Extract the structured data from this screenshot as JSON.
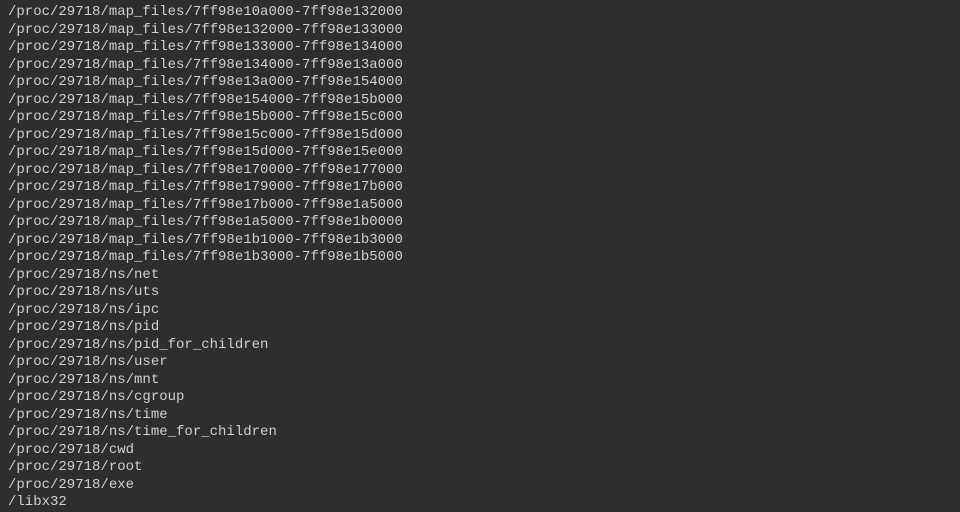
{
  "terminal": {
    "lines": [
      "/proc/29718/map_files/7ff98e10a000-7ff98e132000",
      "/proc/29718/map_files/7ff98e132000-7ff98e133000",
      "/proc/29718/map_files/7ff98e133000-7ff98e134000",
      "/proc/29718/map_files/7ff98e134000-7ff98e13a000",
      "/proc/29718/map_files/7ff98e13a000-7ff98e154000",
      "/proc/29718/map_files/7ff98e154000-7ff98e15b000",
      "/proc/29718/map_files/7ff98e15b000-7ff98e15c000",
      "/proc/29718/map_files/7ff98e15c000-7ff98e15d000",
      "/proc/29718/map_files/7ff98e15d000-7ff98e15e000",
      "/proc/29718/map_files/7ff98e170000-7ff98e177000",
      "/proc/29718/map_files/7ff98e179000-7ff98e17b000",
      "/proc/29718/map_files/7ff98e17b000-7ff98e1a5000",
      "/proc/29718/map_files/7ff98e1a5000-7ff98e1b0000",
      "/proc/29718/map_files/7ff98e1b1000-7ff98e1b3000",
      "/proc/29718/map_files/7ff98e1b3000-7ff98e1b5000",
      "/proc/29718/ns/net",
      "/proc/29718/ns/uts",
      "/proc/29718/ns/ipc",
      "/proc/29718/ns/pid",
      "/proc/29718/ns/pid_for_children",
      "/proc/29718/ns/user",
      "/proc/29718/ns/mnt",
      "/proc/29718/ns/cgroup",
      "/proc/29718/ns/time",
      "/proc/29718/ns/time_for_children",
      "/proc/29718/cwd",
      "/proc/29718/root",
      "/proc/29718/exe",
      "/libx32"
    ]
  }
}
